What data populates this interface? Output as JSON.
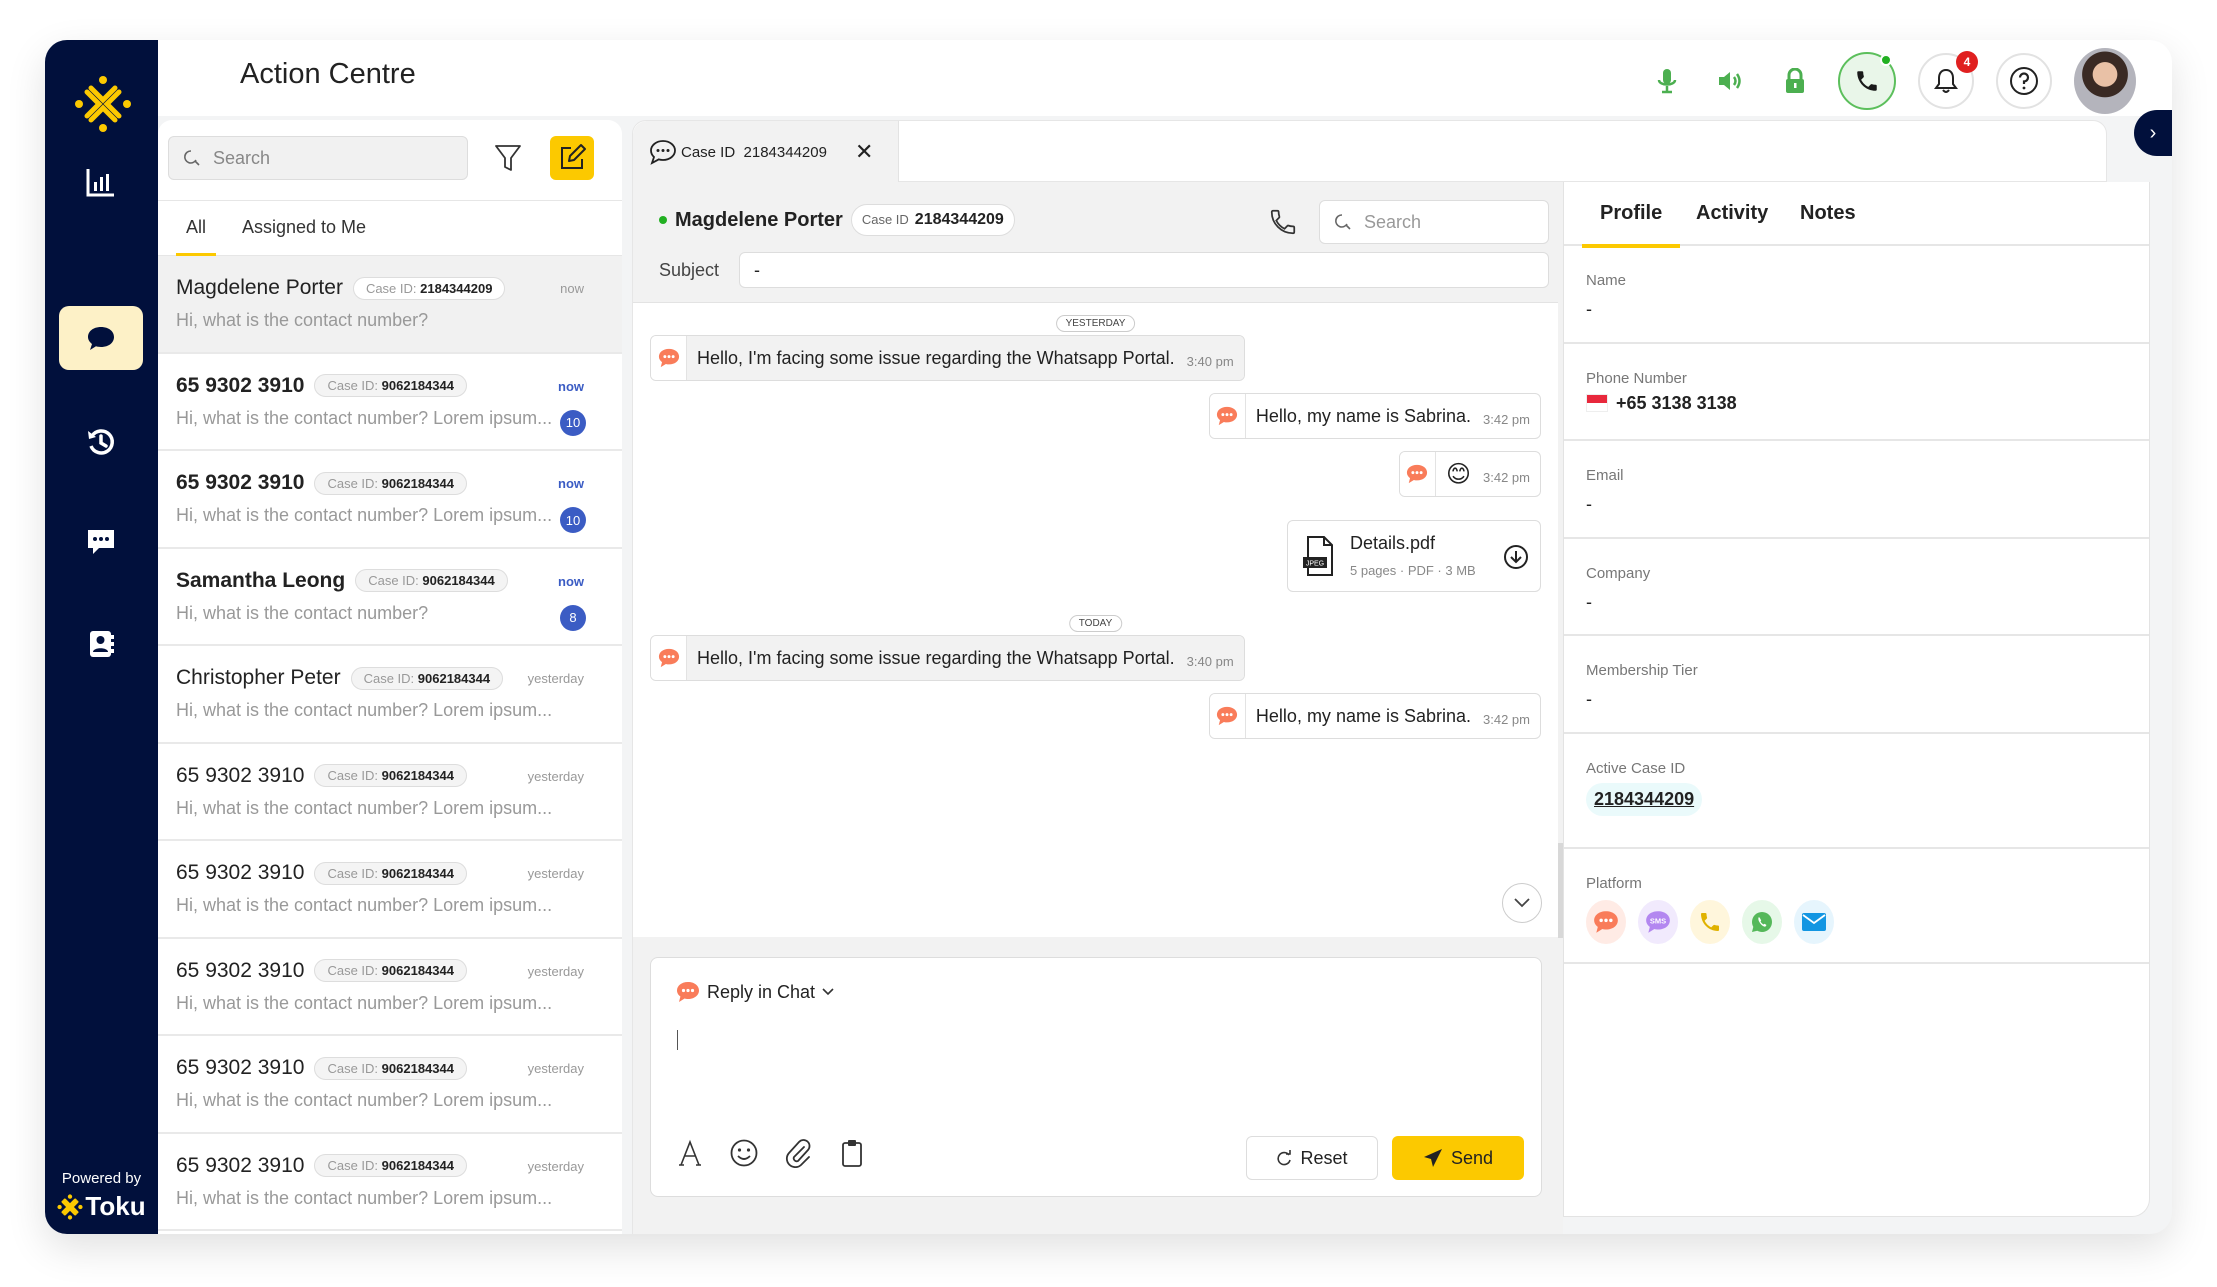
{
  "header": {
    "title": "Action Centre",
    "notification_count": "4",
    "collapse_icon": "chevron-right-icon"
  },
  "sidebar": {
    "items": [
      {
        "name": "analytics",
        "icon": "bar-chart-icon",
        "active": false
      },
      {
        "name": "conversations",
        "icon": "chat-bubble-icon",
        "active": true
      },
      {
        "name": "history",
        "icon": "history-icon",
        "active": false
      },
      {
        "name": "messages",
        "icon": "message-dots-icon",
        "active": false
      },
      {
        "name": "contacts",
        "icon": "contact-book-icon",
        "active": false
      }
    ],
    "powered_by": "Powered by",
    "brand": "Toku"
  },
  "list": {
    "search_placeholder": "Search",
    "tabs": [
      {
        "label": "All",
        "active": true
      },
      {
        "label": "Assigned to Me",
        "active": false
      }
    ],
    "items": [
      {
        "name": "Magdelene Porter",
        "case_label": "Case ID:",
        "case_id": "2184344209",
        "time": "now",
        "preview": "Hi, what is the contact number?",
        "unread": "",
        "selected": true,
        "is_new": false,
        "bold": false
      },
      {
        "name": "65 9302 3910",
        "case_label": "Case ID:",
        "case_id": "9062184344",
        "time": "now",
        "preview": "Hi, what is the contact number? Lorem ipsum...",
        "unread": "10",
        "selected": false,
        "is_new": true,
        "bold": true
      },
      {
        "name": "65 9302 3910",
        "case_label": "Case ID:",
        "case_id": "9062184344",
        "time": "now",
        "preview": "Hi, what is the contact number? Lorem ipsum...",
        "unread": "10",
        "selected": false,
        "is_new": true,
        "bold": true
      },
      {
        "name": "Samantha Leong",
        "case_label": "Case ID:",
        "case_id": "9062184344",
        "time": "now",
        "preview": "Hi, what is the contact number?",
        "unread": "8",
        "selected": false,
        "is_new": true,
        "bold": true
      },
      {
        "name": "Christopher Peter",
        "case_label": "Case ID:",
        "case_id": "9062184344",
        "time": "yesterday",
        "preview": "Hi, what is the contact number? Lorem ipsum...",
        "unread": "",
        "selected": false,
        "is_new": false,
        "bold": false
      },
      {
        "name": "65 9302 3910",
        "case_label": "Case ID:",
        "case_id": "9062184344",
        "time": "yesterday",
        "preview": "Hi, what is the contact number? Lorem ipsum...",
        "unread": "",
        "selected": false,
        "is_new": false,
        "bold": false
      },
      {
        "name": "65 9302 3910",
        "case_label": "Case ID:",
        "case_id": "9062184344",
        "time": "yesterday",
        "preview": "Hi, what is the contact number? Lorem ipsum...",
        "unread": "",
        "selected": false,
        "is_new": false,
        "bold": false
      },
      {
        "name": "65 9302 3910",
        "case_label": "Case ID:",
        "case_id": "9062184344",
        "time": "yesterday",
        "preview": "Hi, what is the contact number? Lorem ipsum...",
        "unread": "",
        "selected": false,
        "is_new": false,
        "bold": false
      },
      {
        "name": "65 9302 3910",
        "case_label": "Case ID:",
        "case_id": "9062184344",
        "time": "yesterday",
        "preview": "Hi, what is the contact number? Lorem ipsum...",
        "unread": "",
        "selected": false,
        "is_new": false,
        "bold": false
      },
      {
        "name": "65 9302 3910",
        "case_label": "Case ID:",
        "case_id": "9062184344",
        "time": "yesterday",
        "preview": "Hi, what is the contact number? Lorem ipsum...",
        "unread": "",
        "selected": false,
        "is_new": false,
        "bold": false
      }
    ]
  },
  "chat": {
    "tab_label": "Case ID  2184344209",
    "contact_name": "Magdelene Porter",
    "case_label": "Case ID",
    "case_id": "2184344209",
    "search_placeholder": "Search",
    "subject_label": "Subject",
    "subject_value": "-",
    "date_yesterday": "YESTERDAY",
    "date_today": "TODAY",
    "messages": [
      {
        "direction": "in",
        "text": "Hello, I'm facing some issue regarding the  Whatsapp Portal.",
        "time": "3:40 pm"
      },
      {
        "direction": "out",
        "text": "Hello, my name is Sabrina.",
        "time": "3:42 pm"
      },
      {
        "direction": "out",
        "text": "😊",
        "time": "3:42 pm"
      },
      {
        "direction": "in",
        "text": "Hello, I'm facing some issue regarding the  Whatsapp Portal.",
        "time": "3:40 pm"
      },
      {
        "direction": "out",
        "text": "Hello, my name is Sabrina.",
        "time": "3:42 pm"
      }
    ],
    "file": {
      "name": "Details.pdf",
      "meta": "5 pages · PDF · 3 MB",
      "type_badge": "JPEG"
    },
    "composer": {
      "mode_label": "Reply in Chat",
      "reset_label": "Reset",
      "send_label": "Send"
    }
  },
  "profile": {
    "tabs": [
      {
        "label": "Profile",
        "active": true
      },
      {
        "label": "Activity",
        "active": false
      },
      {
        "label": "Notes",
        "active": false
      }
    ],
    "fields": {
      "name_label": "Name",
      "name_value": "-",
      "phone_label": "Phone Number",
      "phone_value": "+65 3138 3138",
      "email_label": "Email",
      "email_value": "-",
      "company_label": "Company",
      "company_value": "-",
      "tier_label": "Membership Tier",
      "tier_value": "-",
      "case_label": "Active Case ID",
      "case_value": "2184344209",
      "platform_label": "Platform"
    },
    "platforms": [
      "live-chat",
      "sms",
      "voice-call",
      "whatsapp",
      "email"
    ]
  },
  "colors": {
    "brand_yellow": "#fcc900",
    "sidebar_navy": "#01103c",
    "unread_blue": "#3b5cc4",
    "online_green": "#22b022",
    "chat_orange": "#f97c5a"
  }
}
